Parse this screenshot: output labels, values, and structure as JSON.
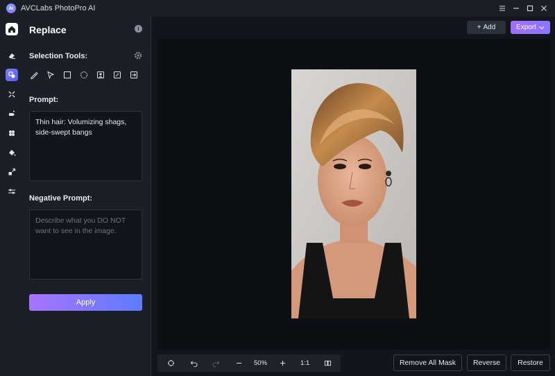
{
  "app": {
    "title": "AVCLabs PhotoPro AI",
    "logo_text": "Ai"
  },
  "rail": {
    "items": [
      {
        "name": "home",
        "icon": "home-icon"
      },
      {
        "name": "eraser",
        "icon": "eraser-icon"
      },
      {
        "name": "replace",
        "icon": "replace-icon",
        "active": true
      },
      {
        "name": "upscale",
        "icon": "expand-icon"
      },
      {
        "name": "colorize",
        "icon": "magic-icon"
      },
      {
        "name": "remove-background",
        "icon": "cutout-icon"
      },
      {
        "name": "fill",
        "icon": "paint-bucket-icon"
      },
      {
        "name": "resize",
        "icon": "resize-icon"
      },
      {
        "name": "adjust",
        "icon": "sliders-icon"
      }
    ]
  },
  "panel": {
    "title": "Replace",
    "info_glyph": "i",
    "selection_tools_label": "Selection Tools:",
    "tools": [
      "brush-icon",
      "lasso-icon",
      "rectangle-icon",
      "ellipse-icon",
      "portrait-icon",
      "edit-icon",
      "import-icon"
    ],
    "prompt_label": "Prompt:",
    "prompt_value": "Thin hair: Volumizing shags, side-swept bangs",
    "negative_prompt_label": "Negative Prompt:",
    "negative_prompt_placeholder": "Describe what you DO NOT want to see in the image.",
    "apply_label": "Apply"
  },
  "toolbar": {
    "add_label": "Add",
    "add_glyph": "+",
    "export_label": "Export"
  },
  "bottom": {
    "zoom": "50%",
    "ratio": "1:1",
    "remove_all_mask_label": "Remove All Mask",
    "reverse_label": "Reverse",
    "restore_label": "Restore"
  },
  "colors": {
    "accent_start": "#a874ff",
    "accent_end": "#5d7bff",
    "background": "#12161c",
    "panel": "#1b2028"
  }
}
